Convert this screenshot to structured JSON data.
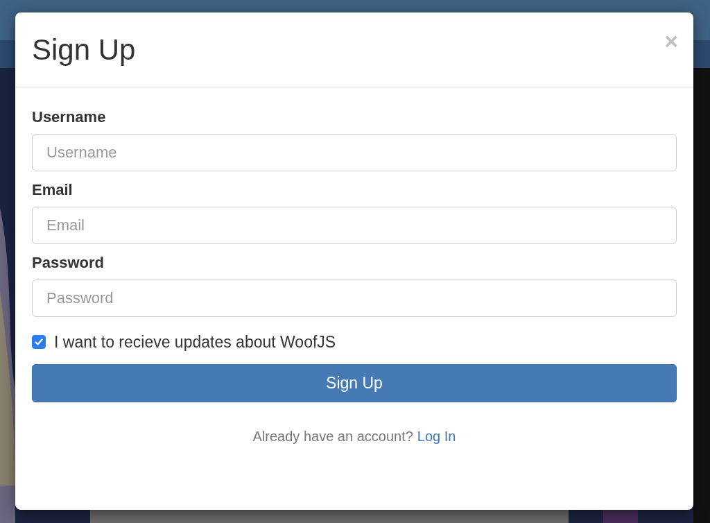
{
  "modal": {
    "title": "Sign Up",
    "close": "×",
    "fields": [
      {
        "label": "Username",
        "placeholder": "Username"
      },
      {
        "label": "Email",
        "placeholder": "Email"
      },
      {
        "label": "Password",
        "placeholder": "Password"
      }
    ],
    "updates": {
      "label": "I want to recieve updates about WoofJS",
      "checked": true
    },
    "submit": "Sign Up",
    "footer": {
      "text": "Already have an account?",
      "link": "Log In"
    }
  }
}
